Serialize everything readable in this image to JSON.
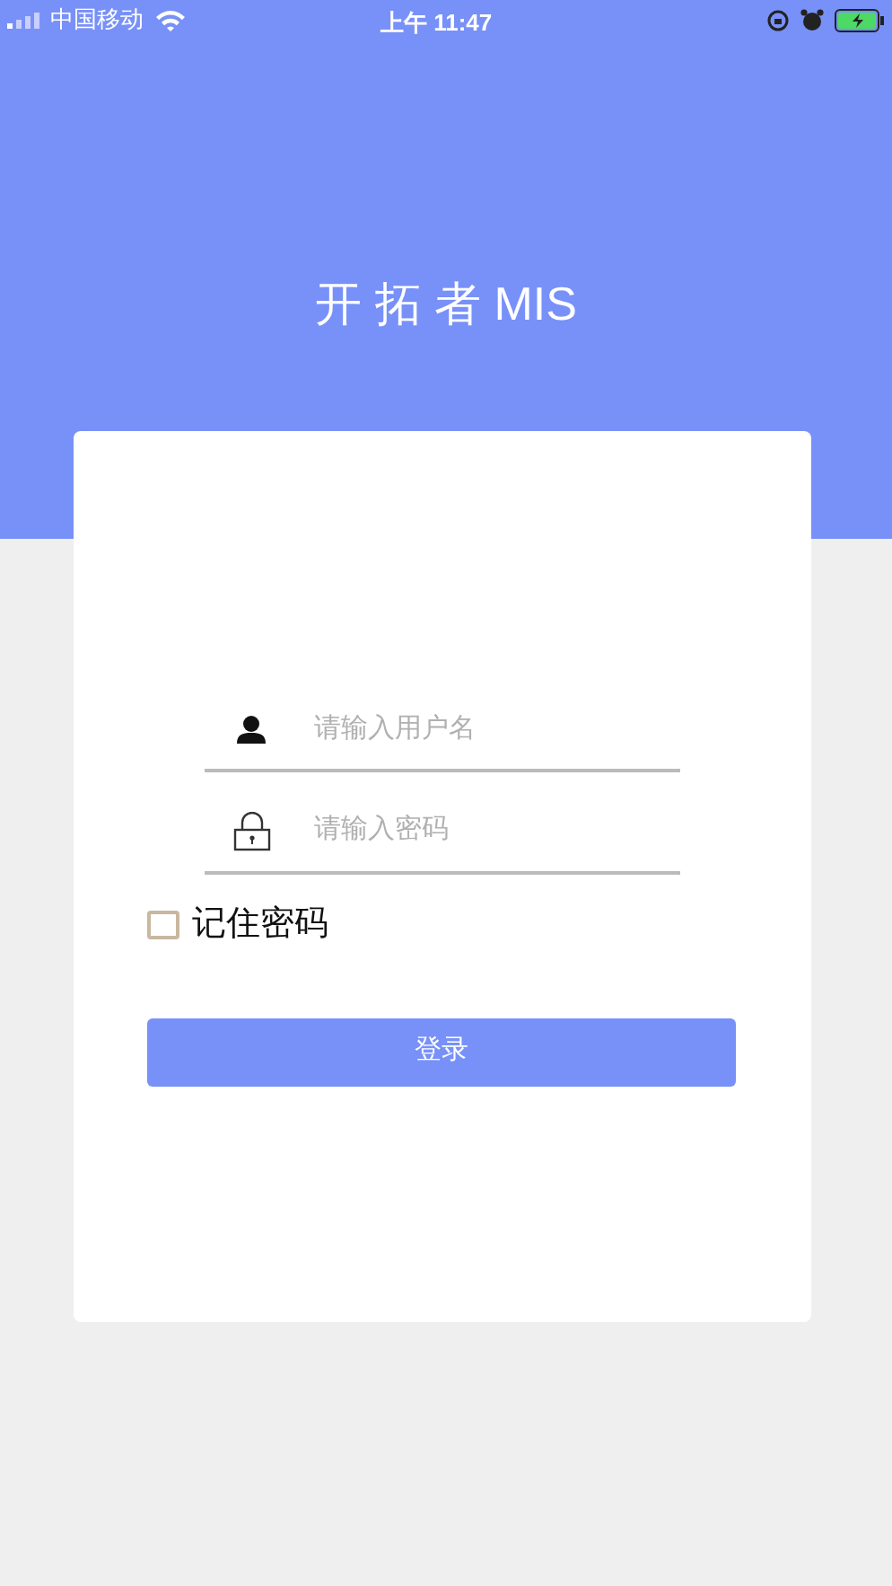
{
  "status_bar": {
    "carrier": "中国移动",
    "time": "上午 11:47"
  },
  "header": {
    "title": "开 拓 者 MIS"
  },
  "form": {
    "username": {
      "placeholder": "请输入用户名"
    },
    "password": {
      "placeholder": "请输入密码"
    },
    "remember": {
      "label": "记住密码",
      "checked": false
    },
    "login_button": "登录"
  }
}
